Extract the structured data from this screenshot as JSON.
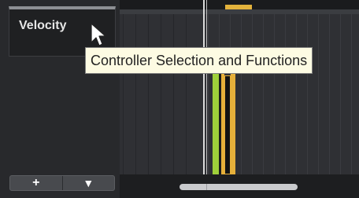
{
  "controller_lane": {
    "label": "Velocity"
  },
  "tooltip": {
    "text": "Controller Selection and Functions"
  },
  "lane_buttons": {
    "add_symbol": "+",
    "menu_symbol": "▼"
  },
  "icons": {
    "cursor": "mouse-pointer-icon",
    "add": "plus-icon",
    "menu": "triangle-down-icon"
  },
  "colors": {
    "velocity_green": "#9fd03a",
    "velocity_yellow": "#e6b03a",
    "tooltip_bg": "#fdfbe3",
    "panel_bg": "#28292c"
  }
}
